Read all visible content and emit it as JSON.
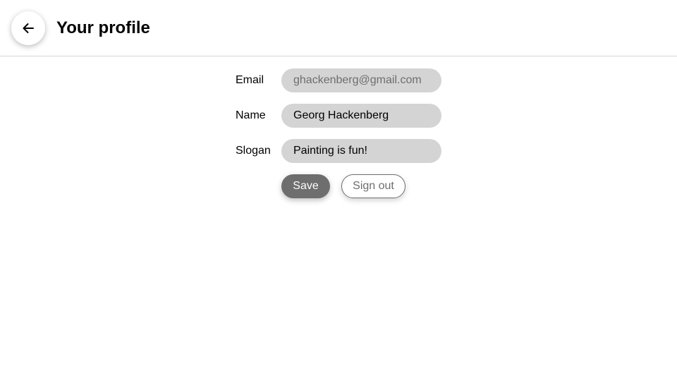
{
  "header": {
    "title": "Your profile",
    "back_icon": "arrow-left-icon"
  },
  "form": {
    "email": {
      "label": "Email",
      "value": "ghackenberg@gmail.com"
    },
    "name": {
      "label": "Name",
      "value": "Georg Hackenberg"
    },
    "slogan": {
      "label": "Slogan",
      "value": "Painting is fun!"
    }
  },
  "actions": {
    "save_label": "Save",
    "signout_label": "Sign out"
  },
  "colors": {
    "field_bg": "#d4d4d4",
    "primary_button": "#6e6e6e",
    "divider": "#d4d4d4"
  }
}
